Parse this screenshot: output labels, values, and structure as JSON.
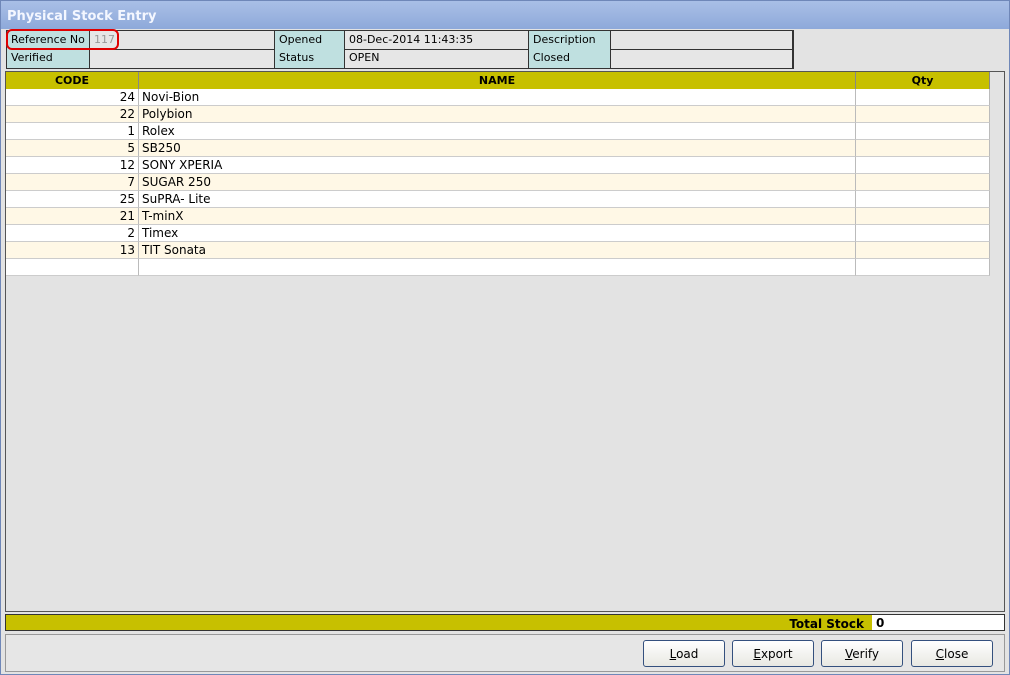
{
  "window": {
    "title": "Physical Stock Entry"
  },
  "header": {
    "reference_label": "Reference No",
    "reference_value": "117",
    "opened_label": "Opened",
    "opened_value": "08-Dec-2014 11:43:35",
    "description_label": "Description",
    "description_value": "",
    "verified_label": "Verified",
    "verified_value": "",
    "status_label": "Status",
    "status_value": "OPEN",
    "closed_label": "Closed",
    "closed_value": ""
  },
  "grid": {
    "columns": [
      "CODE",
      "NAME",
      "Qty"
    ],
    "rows": [
      {
        "code": "24",
        "name": "Novi-Bion",
        "qty": ""
      },
      {
        "code": "22",
        "name": "Polybion",
        "qty": ""
      },
      {
        "code": "1",
        "name": "Rolex",
        "qty": ""
      },
      {
        "code": "5",
        "name": "SB250",
        "qty": ""
      },
      {
        "code": "12",
        "name": "SONY XPERIA",
        "qty": ""
      },
      {
        "code": "7",
        "name": "SUGAR 250",
        "qty": ""
      },
      {
        "code": "25",
        "name": "SuPRA- Lite",
        "qty": ""
      },
      {
        "code": "21",
        "name": "T-minX",
        "qty": ""
      },
      {
        "code": "2",
        "name": "Timex",
        "qty": ""
      },
      {
        "code": "13",
        "name": "TIT Sonata",
        "qty": ""
      },
      {
        "code": "",
        "name": "",
        "qty": ""
      }
    ]
  },
  "total": {
    "label": "Total Stock",
    "value": "0"
  },
  "buttons": {
    "load": "Load",
    "export": "Export",
    "verify": "Verify",
    "close": "Close"
  }
}
